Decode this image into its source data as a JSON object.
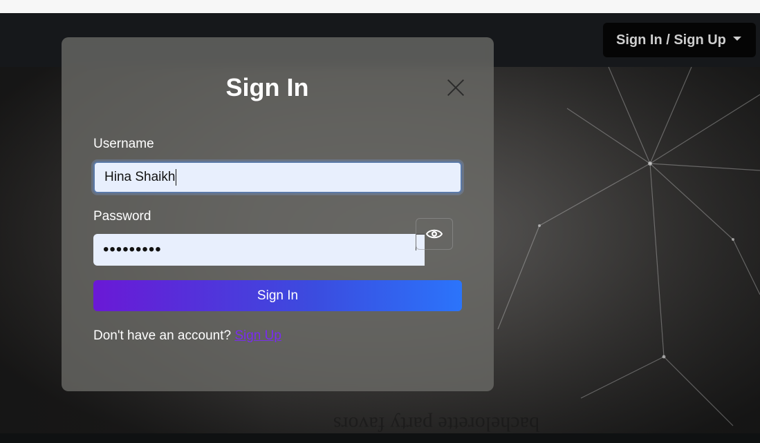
{
  "navbar": {
    "dropdown_label": "Sign In / Sign Up"
  },
  "hero": {
    "background_text": "bachelorette party favors"
  },
  "modal": {
    "title": "Sign In",
    "username_label": "Username",
    "username_value": "Hina Shaikh",
    "password_label": "Password",
    "password_value": "•••••••••",
    "submit_label": "Sign In",
    "footer_prompt": "Don't have an account?",
    "footer_link": "Sign Up"
  },
  "colors": {
    "accent_start": "#6a19d6",
    "accent_end": "#2b74fb",
    "link": "#7a2cf0"
  },
  "icons": {
    "close": "close-icon",
    "toggle_password": "eye-icon",
    "dropdown": "caret-down-icon"
  }
}
